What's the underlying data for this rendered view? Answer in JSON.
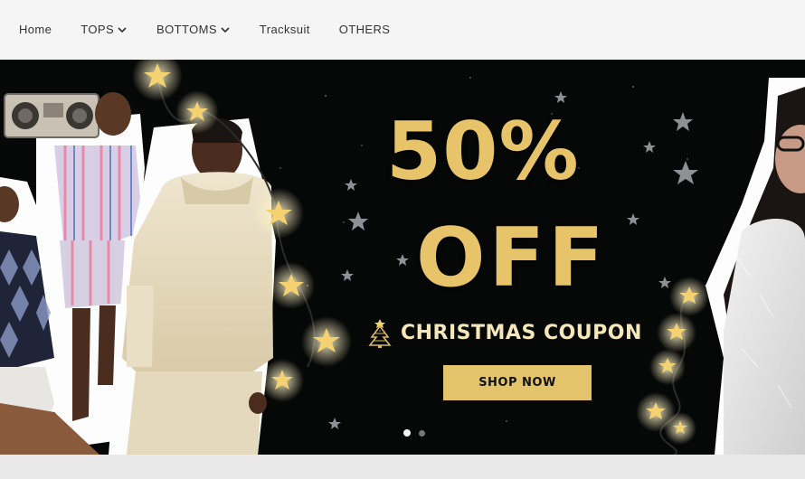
{
  "nav": {
    "items": [
      {
        "label": "Home",
        "has_dropdown": false
      },
      {
        "label": "TOPS",
        "has_dropdown": true
      },
      {
        "label": "BOTTOMS",
        "has_dropdown": true
      },
      {
        "label": "Tracksuit",
        "has_dropdown": false
      },
      {
        "label": "OTHERS",
        "has_dropdown": false
      }
    ]
  },
  "banner": {
    "headline_percent": "50%",
    "headline_off": "OFF",
    "coupon_text": "CHRISTMAS COUPON",
    "cta_label": "SHOP NOW",
    "slide_count": 2,
    "active_slide": 1,
    "colors": {
      "background": "#060707",
      "gold": "#e7c46a",
      "button": "#e4c46a"
    },
    "icons": [
      "christmas-tree-icon",
      "star-icon"
    ]
  }
}
